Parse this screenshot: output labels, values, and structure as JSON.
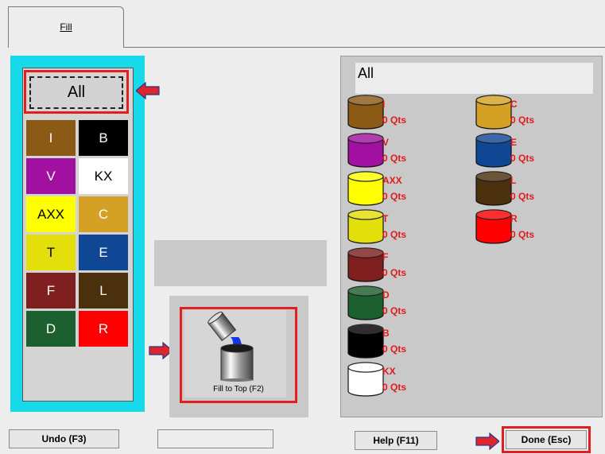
{
  "tab": {
    "label": "Fill"
  },
  "palette": {
    "all_label": "All",
    "swatches": [
      {
        "label": "I",
        "color": "#8b5a14",
        "text_color": "#ffffff"
      },
      {
        "label": "B",
        "color": "#000000",
        "text_color": "#ffffff"
      },
      {
        "label": "V",
        "color": "#a110a1",
        "text_color": "#ffffff"
      },
      {
        "label": "KX",
        "color": "#ffffff",
        "text_color": "#000000"
      },
      {
        "label": "AXX",
        "color": "#ffff00",
        "text_color": "#000000"
      },
      {
        "label": "C",
        "color": "#d4a124",
        "text_color": "#ffffff"
      },
      {
        "label": "T",
        "color": "#e2df0a",
        "text_color": "#000000"
      },
      {
        "label": "E",
        "color": "#0f4795",
        "text_color": "#ffffff"
      },
      {
        "label": "F",
        "color": "#801f1f",
        "text_color": "#ffffff"
      },
      {
        "label": "L",
        "color": "#4a300d",
        "text_color": "#ffffff"
      },
      {
        "label": "D",
        "color": "#1d6030",
        "text_color": "#ffffff"
      },
      {
        "label": "R",
        "color": "#ff0000",
        "text_color": "#ffffff"
      }
    ]
  },
  "fill_button": {
    "label": "Fill to Top (F2)"
  },
  "inventory": {
    "header": "All",
    "left_column": [
      {
        "name": "I",
        "qty": "0 Qts",
        "color": "#8b5a14"
      },
      {
        "name": "V",
        "qty": "0 Qts",
        "color": "#a110a1"
      },
      {
        "name": "AXX",
        "qty": "0 Qts",
        "color": "#ffff00"
      },
      {
        "name": "T",
        "qty": "0 Qts",
        "color": "#e2df0a"
      },
      {
        "name": "F",
        "qty": "0 Qts",
        "color": "#801f1f"
      },
      {
        "name": "D",
        "qty": "0 Qts",
        "color": "#1d6030"
      },
      {
        "name": "B",
        "qty": "0 Qts",
        "color": "#000000"
      },
      {
        "name": "KX",
        "qty": "0 Qts",
        "color": "#ffffff"
      }
    ],
    "right_column": [
      {
        "name": "C",
        "qty": "0 Qts",
        "color": "#d4a124"
      },
      {
        "name": "E",
        "qty": "0 Qts",
        "color": "#0f4795"
      },
      {
        "name": "L",
        "qty": "0 Qts",
        "color": "#4a300d"
      },
      {
        "name": "R",
        "qty": "0 Qts",
        "color": "#ff0000"
      }
    ]
  },
  "bottom": {
    "undo_label": "Undo (F3)",
    "help_label": "Help (F11)",
    "done_label": "Done (Esc)"
  },
  "colors": {
    "highlight": "#e21f1f",
    "accent": "#18d9ea",
    "label": "#e11b1b"
  }
}
